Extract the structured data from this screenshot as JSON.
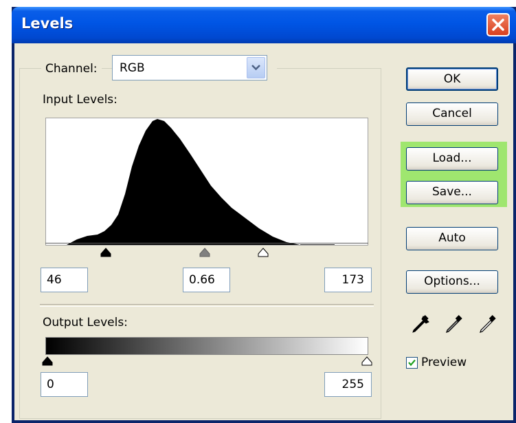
{
  "window": {
    "title": "Levels"
  },
  "channel": {
    "label": "Channel:",
    "value": "RGB"
  },
  "input_levels": {
    "label": "Input Levels:",
    "black": "46",
    "gamma": "0.66",
    "white": "173"
  },
  "output_levels": {
    "label": "Output Levels:",
    "black": "0",
    "white": "255"
  },
  "buttons": {
    "ok": "OK",
    "cancel": "Cancel",
    "load": "Load...",
    "save": "Save...",
    "auto": "Auto",
    "options": "Options..."
  },
  "preview": {
    "label": "Preview",
    "checked": true
  },
  "icons": [
    "close-icon",
    "dropdown-arrow-icon",
    "black-eyedropper-icon",
    "gray-eyedropper-icon",
    "white-eyedropper-icon",
    "checkmark-icon"
  ],
  "colors": {
    "titlebar": "#0055e5",
    "dialog": "#ece9d8",
    "highlight": "#9fe66f",
    "close": "#e04a28"
  }
}
